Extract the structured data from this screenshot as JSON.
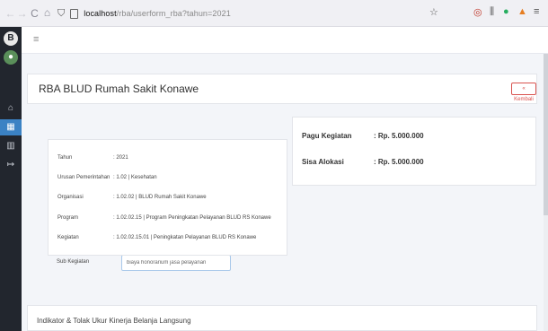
{
  "browser": {
    "back": "←",
    "forward": "→",
    "reload": "C",
    "home": "⌂",
    "url_host": "localhost",
    "url_path": "/rba/userform_rba?tahun=2021"
  },
  "sidebar": {
    "logo": "B"
  },
  "page": {
    "title": "RBA BLUD Rumah Sakit Konawe",
    "back_button": "« Kembali"
  },
  "detail": {
    "rows": [
      {
        "label": "Tahun",
        "value": ": 2021"
      },
      {
        "label": "Urusan Pemerintahan",
        "value": ": 1.02 | Kesehatan"
      },
      {
        "label": "Organisasi",
        "value": ": 1.02.02 | BLUD Rumah Sakit Konawe"
      },
      {
        "label": "Program",
        "value": ": 1.02.02.15 | Program Peningkatan Pelayanan BLUD RS Konawe"
      },
      {
        "label": "Kegiatan",
        "value": ": 1.02.02.15.01 | Peningkatan Pelayanan BLUD RS Konawe"
      }
    ],
    "sub_label": "Sub Kegiatan",
    "sub_value": "biaya honorarium jasa pelayanan"
  },
  "pagu": {
    "label": "Pagu Kegiatan",
    "value": ": Rp. 5.000.000"
  },
  "sisa": {
    "label": "Sisa Alokasi",
    "value": ": Rp. 5.000.000"
  },
  "indikator": {
    "title": "Indikator & Tolak Ukur Kinerja Belanja Langsung"
  },
  "colors": {
    "sidebar": "#22262e",
    "active": "#3b82c4",
    "danger": "#d9534f"
  }
}
